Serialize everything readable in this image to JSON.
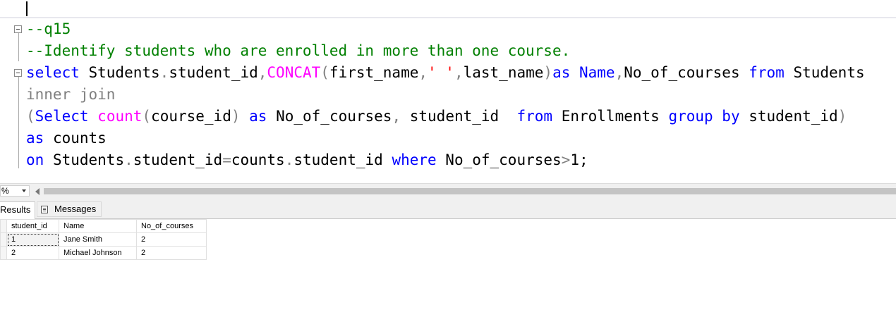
{
  "editor": {
    "lines": [
      {
        "segments": [
          {
            "t": "--q15",
            "c": "cm"
          }
        ]
      },
      {
        "segments": [
          {
            "t": "--Identify students who are enrolled in more than one course.",
            "c": "cm"
          }
        ]
      },
      {
        "segments": [
          {
            "t": "select",
            "c": "kw"
          },
          {
            "t": " Students",
            "c": ""
          },
          {
            "t": ".",
            "c": "op"
          },
          {
            "t": "student_id",
            "c": ""
          },
          {
            "t": ",",
            "c": "op"
          },
          {
            "t": "CONCAT",
            "c": "fn"
          },
          {
            "t": "(",
            "c": "op"
          },
          {
            "t": "first_name",
            "c": ""
          },
          {
            "t": ",",
            "c": "op"
          },
          {
            "t": "' '",
            "c": "st"
          },
          {
            "t": ",",
            "c": "op"
          },
          {
            "t": "last_name",
            "c": ""
          },
          {
            "t": ")",
            "c": "op"
          },
          {
            "t": "as",
            "c": "kw"
          },
          {
            "t": " Name",
            "c": "kw"
          },
          {
            "t": ",",
            "c": "op"
          },
          {
            "t": "No_of_courses ",
            "c": ""
          },
          {
            "t": "from",
            "c": "kw"
          },
          {
            "t": " Students",
            "c": ""
          }
        ]
      },
      {
        "segments": [
          {
            "t": "inner join",
            "c": "gy"
          }
        ]
      },
      {
        "segments": [
          {
            "t": "(",
            "c": "op"
          },
          {
            "t": "Select",
            "c": "kw"
          },
          {
            "t": " ",
            "c": ""
          },
          {
            "t": "count",
            "c": "fn"
          },
          {
            "t": "(",
            "c": "op"
          },
          {
            "t": "course_id",
            "c": ""
          },
          {
            "t": ")",
            "c": "op"
          },
          {
            "t": " as",
            "c": "kw"
          },
          {
            "t": " No_of_courses",
            "c": ""
          },
          {
            "t": ",",
            "c": "op"
          },
          {
            "t": " student_id  ",
            "c": ""
          },
          {
            "t": "from",
            "c": "kw"
          },
          {
            "t": " Enrollments ",
            "c": ""
          },
          {
            "t": "group by",
            "c": "kw"
          },
          {
            "t": " student_id",
            "c": ""
          },
          {
            "t": ")",
            "c": "op"
          }
        ]
      },
      {
        "segments": [
          {
            "t": "as",
            "c": "kw"
          },
          {
            "t": " counts",
            "c": ""
          }
        ]
      },
      {
        "segments": [
          {
            "t": "on",
            "c": "kw"
          },
          {
            "t": " Students",
            "c": ""
          },
          {
            "t": ".",
            "c": "op"
          },
          {
            "t": "student_id",
            "c": ""
          },
          {
            "t": "=",
            "c": "op"
          },
          {
            "t": "counts",
            "c": ""
          },
          {
            "t": ".",
            "c": "op"
          },
          {
            "t": "student_id ",
            "c": ""
          },
          {
            "t": "where",
            "c": "kw"
          },
          {
            "t": " No_of_courses",
            "c": ""
          },
          {
            "t": ">",
            "c": "op"
          },
          {
            "t": "1;",
            "c": ""
          }
        ]
      }
    ]
  },
  "statusbar": {
    "zoom": "%"
  },
  "results": {
    "tabs": {
      "results": "Results",
      "messages": "Messages"
    },
    "columns": [
      "student_id",
      "Name",
      "No_of_courses"
    ],
    "rows": [
      [
        "1",
        "Jane Smith",
        "2"
      ],
      [
        "2",
        "Michael Johnson",
        "2"
      ]
    ]
  }
}
